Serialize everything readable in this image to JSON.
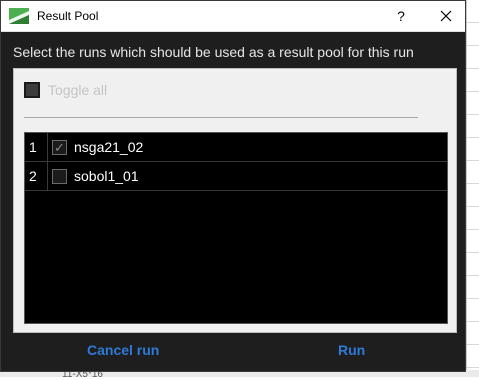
{
  "window": {
    "title": "Result Pool",
    "help_label": "?",
    "icon": "app-logo-icon",
    "close_icon": "close-icon"
  },
  "instructions": "Select the runs which should be used as a result pool for this run",
  "toggle_all": {
    "label": "Toggle all",
    "checked": false,
    "enabled": false
  },
  "runs": [
    {
      "index": "1",
      "name": "nsga21_02",
      "checked": true,
      "enabled": false
    },
    {
      "index": "2",
      "name": "sobol1_01",
      "checked": false,
      "enabled": true
    }
  ],
  "buttons": {
    "cancel": "Cancel run",
    "run": "Run"
  },
  "background_ghost_text": "11-X5*16",
  "colors": {
    "dialog_bg": "#1e1e1e",
    "panel_bg": "#f0f0f0",
    "table_bg": "#000000",
    "accent": "#2f7ad8",
    "icon_green": "#4caf50"
  }
}
